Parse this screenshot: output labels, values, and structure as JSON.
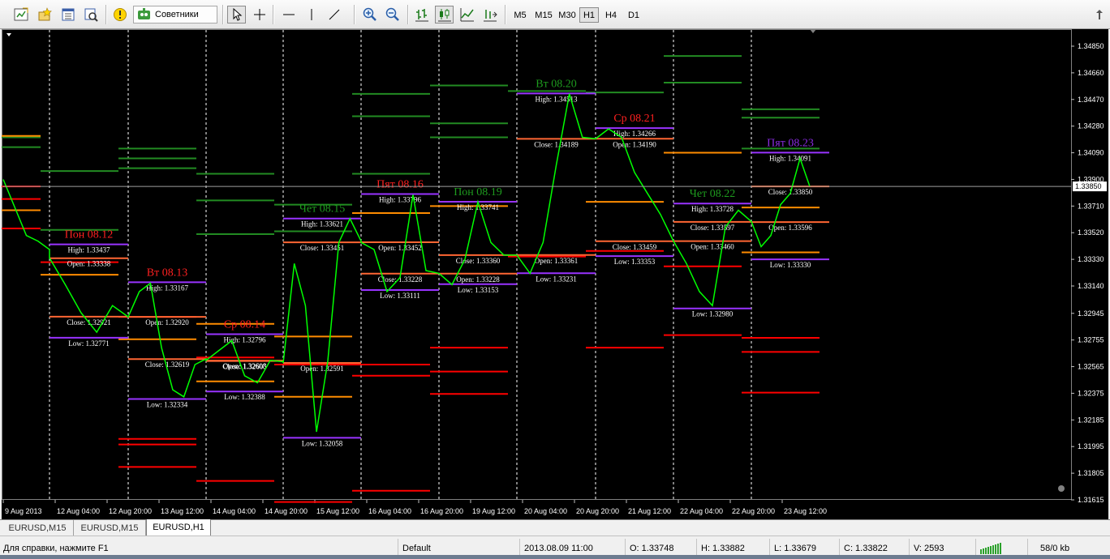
{
  "toolbar": {
    "advisors_label": "Советники",
    "timeframes": [
      "M5",
      "M15",
      "M30",
      "H1",
      "H4",
      "D1"
    ],
    "active_timeframe": "H1"
  },
  "chart": {
    "current_price": "1.33850",
    "price_axis": [
      "1.34850",
      "1.34660",
      "1.34470",
      "1.34280",
      "1.34090",
      "1.33900",
      "1.33710",
      "1.33520",
      "1.33330",
      "1.33140",
      "1.32945",
      "1.32755",
      "1.32565",
      "1.32375",
      "1.32185",
      "1.31995",
      "1.31805",
      "1.31615"
    ],
    "time_axis": [
      "9 Aug 2013",
      "12 Aug 04:00",
      "12 Aug 20:00",
      "13 Aug 12:00",
      "14 Aug 04:00",
      "14 Aug 20:00",
      "15 Aug 12:00",
      "16 Aug 04:00",
      "16 Aug 20:00",
      "19 Aug 12:00",
      "20 Aug 04:00",
      "20 Aug 20:00",
      "21 Aug 12:00",
      "22 Aug 04:00",
      "22 Aug 20:00",
      "23 Aug 12:00"
    ],
    "days": [
      {
        "title": "Пон 08.12",
        "high": "High: 1.33437",
        "open": "Open: 1.33338",
        "close": "Close: 1.32921",
        "low": "Low: 1.32771"
      },
      {
        "title": "Вт 08.13",
        "high": "High: 1.33167",
        "open": "Open: 1.32920",
        "close": "Close: 1.32619",
        "low": "Low: 1.32334"
      },
      {
        "title": "Ср 08.14",
        "high": "High: 1.32796",
        "open": "Open: 1.32608",
        "close": "Close: 1.32605",
        "low": "Low: 1.32388"
      },
      {
        "title": "Чет 08.15",
        "high": "High: 1.33621",
        "open": "Open: 1.32591",
        "close": "Close: 1.33451",
        "low": "Low: 1.32058"
      },
      {
        "title": "Пят 08.16",
        "high": "High: 1.33796",
        "open": "Open: 1.33452",
        "close": "Close: 1.33228",
        "low": "Low: 1.33111"
      },
      {
        "title": "Пон 08.19",
        "high": "High: 1.33741",
        "open": "Open: 1.33228",
        "close": "Close: 1.33360",
        "low": "Low: 1.33153"
      },
      {
        "title": "Вт 08.20",
        "high": "High: 1.34513",
        "open": "Open: 1.33361",
        "close": "Close: 1.34189",
        "low": "Low: 1.33231"
      },
      {
        "title": "Ср 08.21",
        "high": "High: 1.34266",
        "open": "Open: 1.34190",
        "close": "Close: 1.33459",
        "low": "Low: 1.33353"
      },
      {
        "title": "Чет 08.22",
        "high": "High: 1.33728",
        "open": "Open: 1.33460",
        "close": "Close: 1.33597",
        "low": "Low: 1.32980"
      },
      {
        "title": "Пят 08.23",
        "high": "High: 1.34091",
        "open": "Open: 1.33596",
        "close": "Close: 1.33850",
        "low": "Low: 1.33330"
      }
    ],
    "colors": {
      "background": "#000000",
      "candles": "#00ff00",
      "high_low_line": "#9933ff",
      "open_close_line": "#ff6633",
      "resistance": "#228b22",
      "support": "#ff0000",
      "pivot": "#ff8c00",
      "title_red": "#ff2020",
      "title_green": "#1e9b1e",
      "title_purple": "#8a2be2"
    }
  },
  "tabs": [
    "EURUSD,M15",
    "EURUSD,M15",
    "EURUSD,H1"
  ],
  "active_tab": "EURUSD,H1",
  "status": {
    "help": "Для справки, нажмите F1",
    "profile": "Default",
    "datetime": "2013.08.09 11:00",
    "open": "O: 1.33748",
    "high": "H: 1.33882",
    "low": "L: 1.33679",
    "close": "C: 1.33822",
    "volume": "V: 2593",
    "traffic": "58/0 kb"
  }
}
